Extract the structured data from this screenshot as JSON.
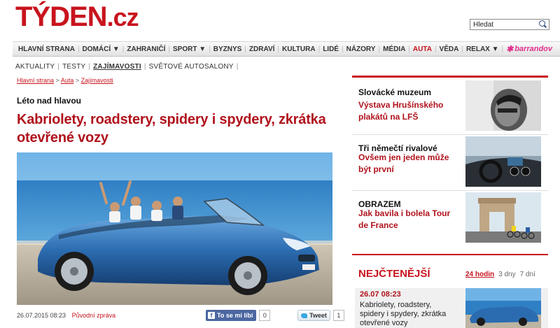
{
  "header": {
    "logo_text": "TÝDEN",
    "logo_domain": ".cz",
    "search": {
      "value": "Hledat",
      "icon": "search-icon"
    }
  },
  "nav": {
    "items": [
      {
        "label": "HLAVNÍ STRANA",
        "active": false
      },
      {
        "label": "DOMÁCÍ ▼",
        "active": false
      },
      {
        "label": "ZAHRANIČÍ",
        "active": false
      },
      {
        "label": "SPORT ▼",
        "active": false
      },
      {
        "label": "BYZNYS",
        "active": false
      },
      {
        "label": "ZDRAVÍ",
        "active": false
      },
      {
        "label": "KULTURA",
        "active": false
      },
      {
        "label": "LIDÉ",
        "active": false
      },
      {
        "label": "NÁZORY",
        "active": false
      },
      {
        "label": "MÉDIA",
        "active": false
      },
      {
        "label": "AUTA",
        "active": true
      },
      {
        "label": "VĚDA",
        "active": false
      },
      {
        "label": "RELAX ▼",
        "active": false
      }
    ],
    "partner": "barrandov",
    "active_color": "#c8141e",
    "partner_color": "#e0308c"
  },
  "subnav": {
    "items": [
      {
        "label": "AKTUALITY",
        "current": false
      },
      {
        "label": "TESTY",
        "current": false
      },
      {
        "label": "ZAJÍMAVOSTI",
        "current": true
      },
      {
        "label": "SVĚTOVÉ AUTOSALONY",
        "current": false
      }
    ]
  },
  "breadcrumb": {
    "items": [
      "Hlavní strana",
      "Auta",
      "Zajímavosti"
    ],
    "separator": ">"
  },
  "article": {
    "kicker": "Léto nad hlavou",
    "title": "Kabriolety, roadstery, spidery i spydery, zkrátka otevřené vozy",
    "date": "26.07.2015 08:23",
    "source_link": "Původní zpráva",
    "fb_label": "To se mi líbí",
    "fb_count": "0",
    "tweet_label": "Tweet",
    "tweet_count": "1",
    "title_color": "#b0121c"
  },
  "sidebar": {
    "cards": [
      {
        "title": "Slovácké muzeum",
        "subtitle": "Výstava Hrušínského plakátů na LFŠ"
      },
      {
        "title": "Tři němečtí rivalové",
        "subtitle": "Ovšem jen jeden může být první"
      },
      {
        "title": "OBRAZEM",
        "subtitle": "Jak bavila i bolela Tour de France"
      }
    ]
  },
  "most_read": {
    "title": "NEJČTENĚJŠÍ",
    "tabs": [
      {
        "label": "24 hodin",
        "active": true
      },
      {
        "label": "3 dny",
        "active": false
      },
      {
        "label": "7 dní",
        "active": false
      }
    ],
    "items": [
      {
        "date": "26.07 08:23",
        "title": "Kabriolety, roadstery, spidery i spydery, zkrátka otevřené vozy"
      }
    ]
  }
}
